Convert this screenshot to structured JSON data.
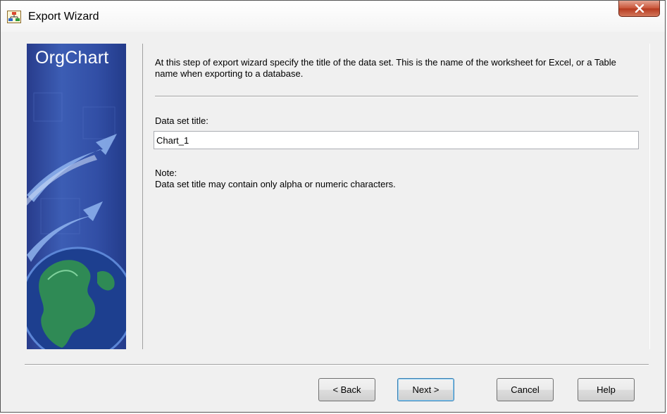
{
  "window": {
    "title": "Export Wizard"
  },
  "sidebar": {
    "brand": "OrgChart"
  },
  "step": {
    "description": "At this step of export wizard specify the title of the data set. This is the name of the worksheet for Excel, or a Table name when exporting to a database.",
    "field_label": "Data set title:",
    "field_value": "Chart_1",
    "note_label": "Note:",
    "note_text": "Data set title may contain only alpha or numeric characters."
  },
  "buttons": {
    "back": "< Back",
    "next": "Next >",
    "cancel": "Cancel",
    "help": "Help"
  },
  "colors": {
    "side_panel": "#3c5db4",
    "close_button": "#c85337"
  }
}
